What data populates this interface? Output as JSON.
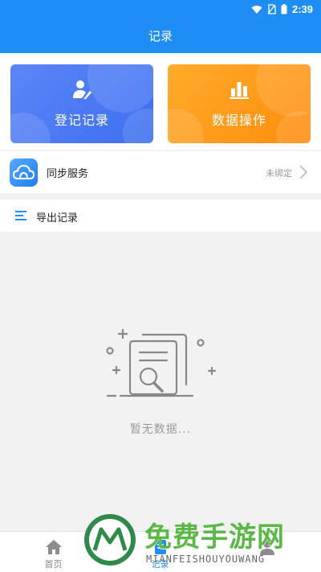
{
  "statusbar": {
    "time": "2:39"
  },
  "appbar": {
    "title": "记录"
  },
  "cards": [
    {
      "label": "登记记录",
      "icon": "user-edit-icon",
      "color": "#4a7bf4"
    },
    {
      "label": "数据操作",
      "icon": "bar-chart-icon",
      "color": "#ff9b1a"
    }
  ],
  "sync": {
    "title": "同步服务",
    "status": "未绑定",
    "icon": "cloud-icon"
  },
  "export": {
    "title": "导出记录",
    "icon": "menu-lines-icon"
  },
  "empty": {
    "text": "暂无数据..."
  },
  "tabbar": {
    "tabs": [
      {
        "label": "首页",
        "icon": "home-icon"
      },
      {
        "label": "记录",
        "icon": "record-icon"
      },
      {
        "label": "",
        "icon": "profile-icon"
      }
    ],
    "active_index": 1
  },
  "watermark": {
    "cn": "免费手游网",
    "en": "MIANFEISHOUYOUWANG"
  },
  "colors": {
    "primary": "#1e8ef5",
    "accent_blue": "#4a7bf4",
    "accent_orange": "#ff9b1a",
    "watermark_green": "#5ab946"
  }
}
